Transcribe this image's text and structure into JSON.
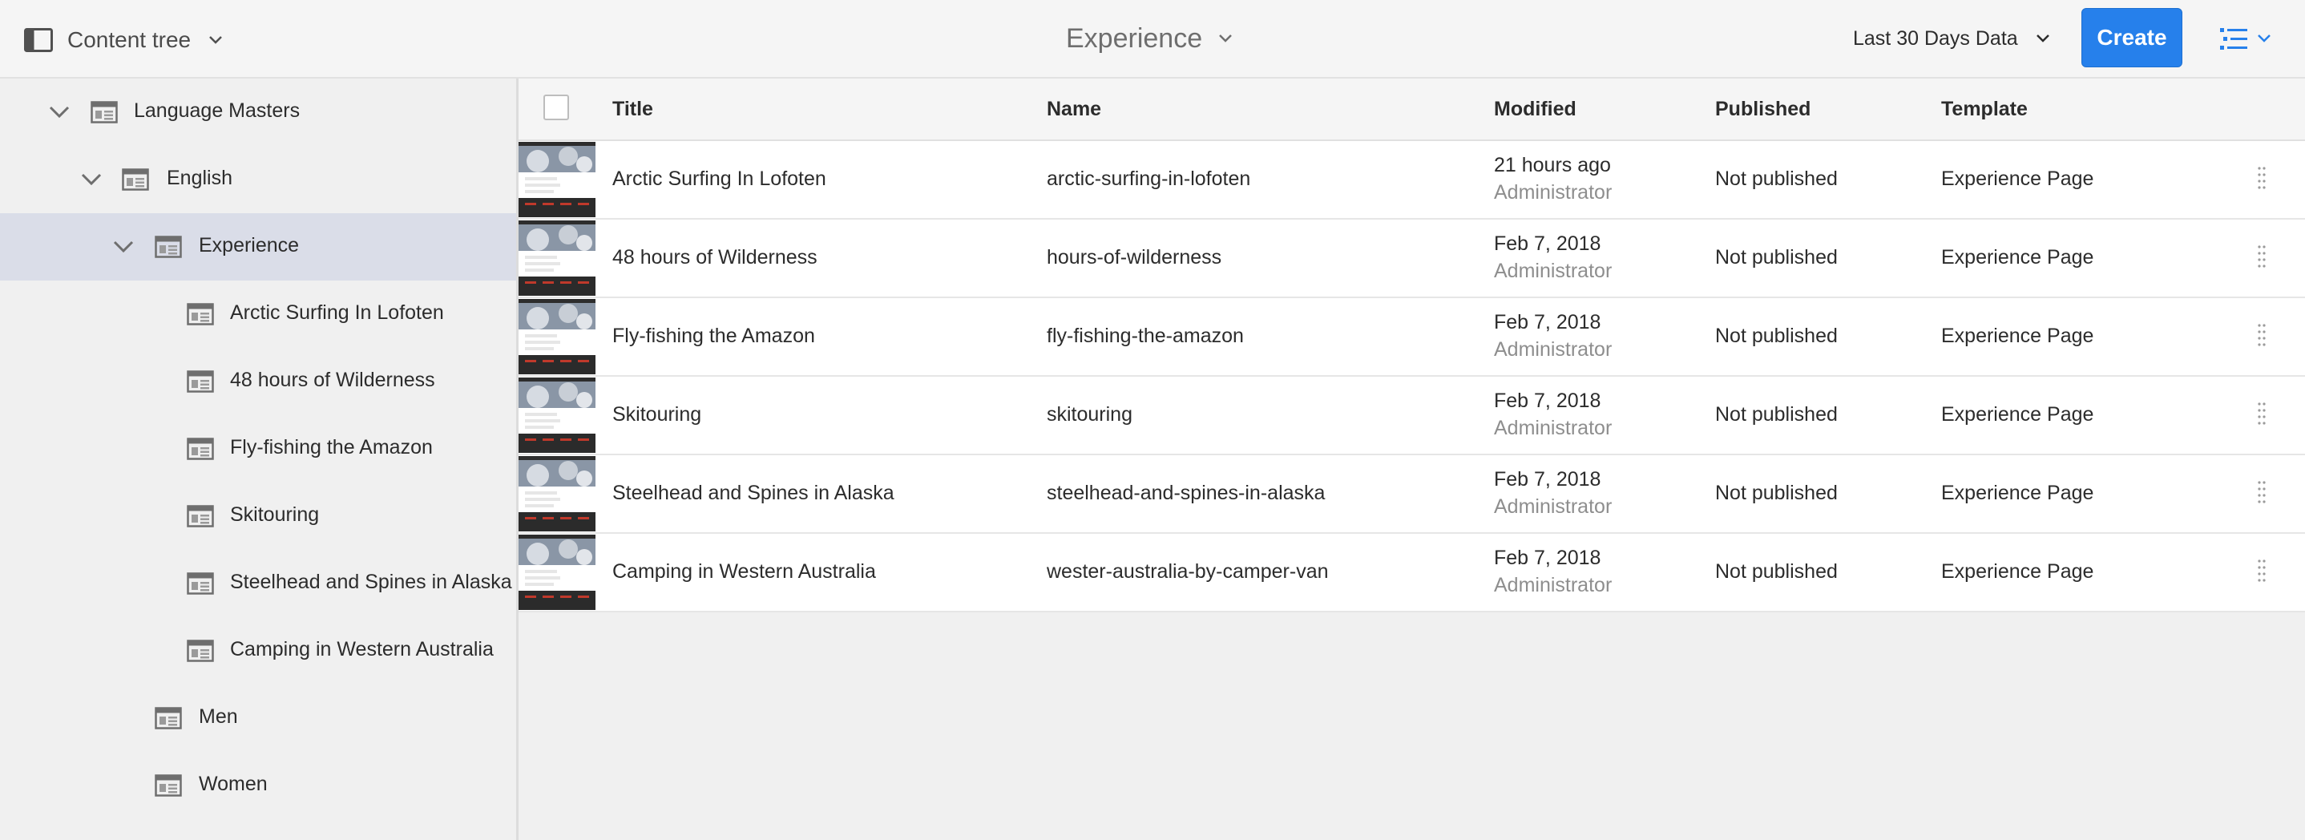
{
  "toolbar": {
    "rail_label": "Content tree",
    "title": "Experience",
    "period_label": "Last 30 Days Data",
    "create_label": "Create"
  },
  "colors": {
    "accent": "#2680eb",
    "selected_row": "#dadde8",
    "muted_text": "#8e8e8e"
  },
  "tree": [
    {
      "label": "Language Masters",
      "expanded": true
    },
    {
      "label": "English",
      "expanded": true
    },
    {
      "label": "Experience",
      "expanded": true,
      "selected": true
    },
    {
      "label": "Arctic Surfing In Lofoten"
    },
    {
      "label": "48 hours of Wilderness"
    },
    {
      "label": "Fly-fishing the Amazon"
    },
    {
      "label": "Skitouring"
    },
    {
      "label": "Steelhead and Spines in Alaska"
    },
    {
      "label": "Camping in Western Australia"
    },
    {
      "label": "Men"
    },
    {
      "label": "Women"
    }
  ],
  "table": {
    "columns": [
      "Title",
      "Name",
      "Modified",
      "Published",
      "Template"
    ],
    "rows": [
      {
        "title": "Arctic Surfing In Lofoten",
        "name": "arctic-surfing-in-lofoten",
        "modified": "21 hours ago",
        "modified_by": "Administrator",
        "published": "Not published",
        "template": "Experience Page"
      },
      {
        "title": "48 hours of Wilderness",
        "name": "hours-of-wilderness",
        "modified": "Feb 7, 2018",
        "modified_by": "Administrator",
        "published": "Not published",
        "template": "Experience Page"
      },
      {
        "title": "Fly-fishing the Amazon",
        "name": "fly-fishing-the-amazon",
        "modified": "Feb 7, 2018",
        "modified_by": "Administrator",
        "published": "Not published",
        "template": "Experience Page"
      },
      {
        "title": "Skitouring",
        "name": "skitouring",
        "modified": "Feb 7, 2018",
        "modified_by": "Administrator",
        "published": "Not published",
        "template": "Experience Page"
      },
      {
        "title": "Steelhead and Spines in Alaska",
        "name": "steelhead-and-spines-in-alaska",
        "modified": "Feb 7, 2018",
        "modified_by": "Administrator",
        "published": "Not published",
        "template": "Experience Page"
      },
      {
        "title": "Camping in Western Australia",
        "name": "wester-australia-by-camper-van",
        "modified": "Feb 7, 2018",
        "modified_by": "Administrator",
        "published": "Not published",
        "template": "Experience Page"
      }
    ]
  }
}
